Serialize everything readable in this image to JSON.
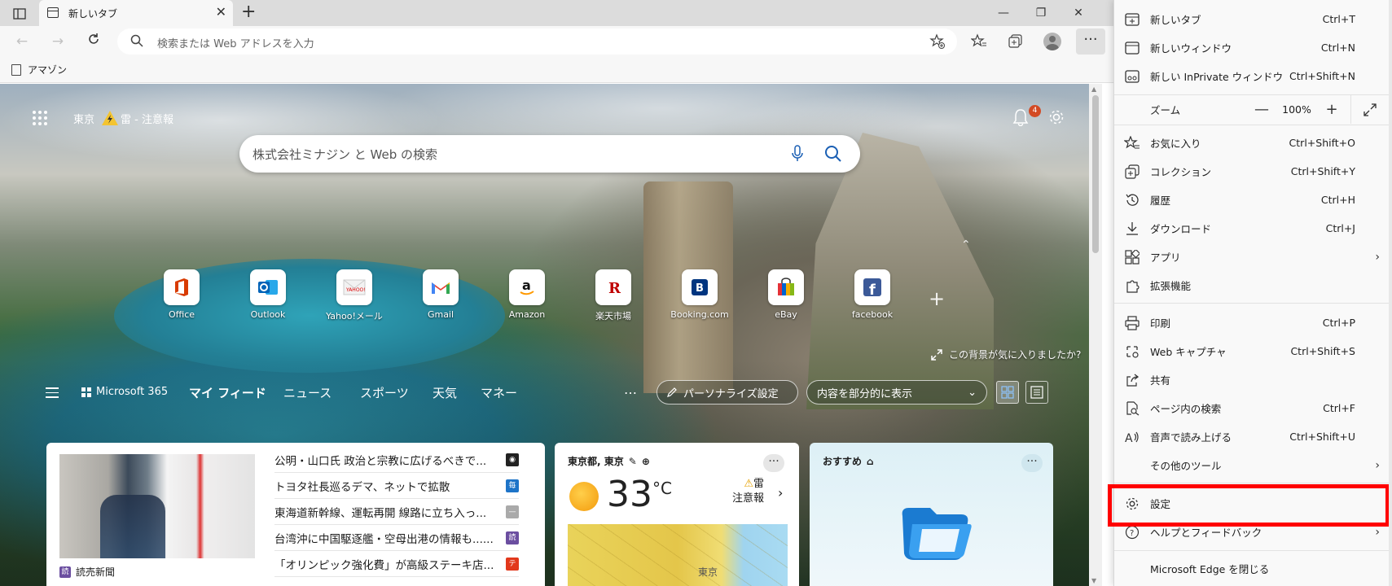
{
  "window": {
    "tab_title": "新しいタブ",
    "address_placeholder": "検索または Web アドレスを入力"
  },
  "favorites_bar": {
    "items": [
      {
        "label": "アマゾン"
      }
    ]
  },
  "newtab": {
    "location": "東京",
    "weather_alert": "雷 - 注意報",
    "notification_count": "4",
    "search_placeholder": "株式会社ミナジン と Web の検索",
    "tiles": [
      {
        "label": "Office"
      },
      {
        "label": "Outlook"
      },
      {
        "label": "Yahoo!メール"
      },
      {
        "label": "Gmail"
      },
      {
        "label": "Amazon"
      },
      {
        "label": "楽天市場"
      },
      {
        "label": "Booking.com"
      },
      {
        "label": "eBay"
      },
      {
        "label": "facebook"
      }
    ],
    "like_background": "この背景が気に入りましたか?",
    "feed": {
      "ms365": "Microsoft 365",
      "tabs": [
        "マイ フィード",
        "ニュース",
        "スポーツ",
        "天気",
        "マネー"
      ],
      "more": "…",
      "personalize": "パーソナライズ設定",
      "display_select": "内容を部分的に表示"
    },
    "news": {
      "source": "読売新聞",
      "source_badge": "読",
      "headlines": [
        {
          "text": "公明・山口氏 政治と宗教に広げるべきで...",
          "color": "#222222"
        },
        {
          "text": "トヨタ社長巡るデマ、ネットで拡散",
          "color": "#1e74c8"
        },
        {
          "text": "東海道新幹線、運転再開 線路に立ち入っ...",
          "color": "#888888"
        },
        {
          "text": "台湾沖に中国駆逐艦・空母出港の情報も......",
          "color": "#6b4ea0"
        },
        {
          "text": "「オリンピック強化費」が高級ステーキ店...",
          "color": "#e2381b"
        }
      ]
    },
    "weather": {
      "location": "東京都, 東京",
      "temp": "33",
      "unit": "°C",
      "alert_line1": "雷",
      "alert_line2": "注意報",
      "map_label": "東京"
    },
    "recommend": {
      "title": "おすすめ"
    }
  },
  "menu": {
    "items": [
      {
        "label": "新しいタブ",
        "shortcut": "Ctrl+T"
      },
      {
        "label": "新しいウィンドウ",
        "shortcut": "Ctrl+N"
      },
      {
        "label": "新しい InPrivate ウィンドウ",
        "shortcut": "Ctrl+Shift+N"
      },
      {
        "label": "ズーム",
        "value": "100%"
      },
      {
        "label": "お気に入り",
        "shortcut": "Ctrl+Shift+O"
      },
      {
        "label": "コレクション",
        "shortcut": "Ctrl+Shift+Y"
      },
      {
        "label": "履歴",
        "shortcut": "Ctrl+H"
      },
      {
        "label": "ダウンロード",
        "shortcut": "Ctrl+J"
      },
      {
        "label": "アプリ"
      },
      {
        "label": "拡張機能"
      },
      {
        "label": "印刷",
        "shortcut": "Ctrl+P"
      },
      {
        "label": "Web キャプチャ",
        "shortcut": "Ctrl+Shift+S"
      },
      {
        "label": "共有"
      },
      {
        "label": "ページ内の検索",
        "shortcut": "Ctrl+F"
      },
      {
        "label": "音声で読み上げる",
        "shortcut": "Ctrl+Shift+U"
      },
      {
        "label": "その他のツール"
      },
      {
        "label": "設定"
      },
      {
        "label": "ヘルプとフィードバック"
      },
      {
        "label": "Microsoft Edge を閉じる"
      }
    ],
    "highlight_color": "#ff0000"
  }
}
